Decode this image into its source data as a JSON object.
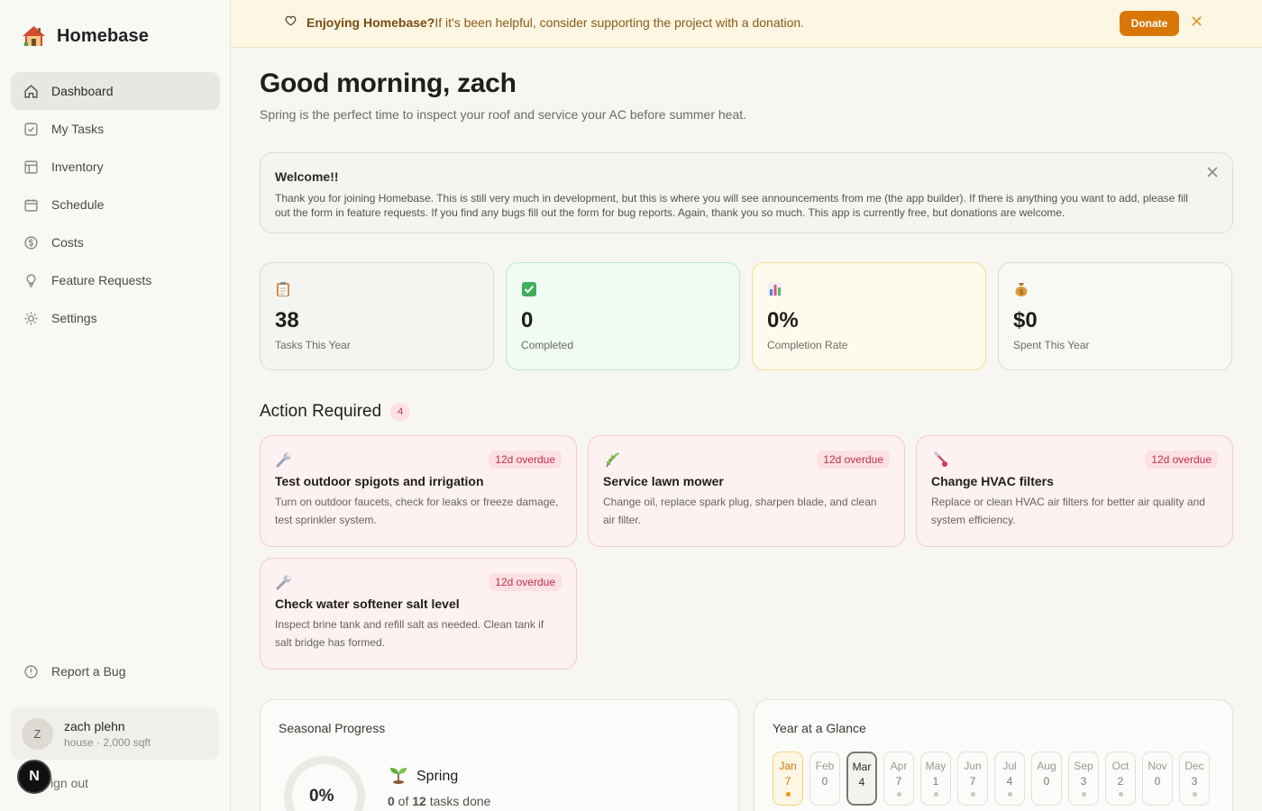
{
  "app": {
    "name": "Homebase"
  },
  "sidebar": {
    "items": [
      {
        "label": "Dashboard",
        "icon": "home-icon",
        "active": true
      },
      {
        "label": "My Tasks",
        "icon": "checkbox-icon"
      },
      {
        "label": "Inventory",
        "icon": "table-icon"
      },
      {
        "label": "Schedule",
        "icon": "calendar-icon"
      },
      {
        "label": "Costs",
        "icon": "coin-icon"
      },
      {
        "label": "Feature Requests",
        "icon": "lightbulb-icon"
      },
      {
        "label": "Settings",
        "icon": "sun-icon"
      }
    ],
    "report_bug": "Report a Bug",
    "user": {
      "initial": "Z",
      "name": "zach plehn",
      "sub": "house · 2,000 sqft"
    },
    "sign_out": "ign out",
    "n_badge": "N"
  },
  "banner": {
    "bold": "Enjoying Homebase?",
    "text": "If it's been helpful, consider supporting the project with a donation.",
    "donate": "Donate",
    "close": "✕"
  },
  "main": {
    "greeting": "Good morning, zach",
    "subtitle": "Spring is the perfect time to inspect your roof and service your AC before summer heat.",
    "welcome": {
      "title": "Welcome!!",
      "body": "Thank you for joining Homebase. This is still very much in development, but this is where you will see announcements from me (the app builder). If there is anything you want to add, please fill out the form in feature requests. If you find any bugs fill out the form for bug reports. Again, thank you so much. This app is currently free, but donations are welcome."
    },
    "stats": [
      {
        "value": "38",
        "label": "Tasks This Year",
        "icon": "clipboard-icon"
      },
      {
        "value": "0",
        "label": "Completed",
        "icon": "check-box-icon"
      },
      {
        "value": "0%",
        "label": "Completion Rate",
        "icon": "bar-chart-icon"
      },
      {
        "value": "$0",
        "label": "Spent This Year",
        "icon": "money-bag-icon"
      }
    ],
    "action_required": {
      "title": "Action Required",
      "count": "4"
    },
    "tasks": [
      {
        "title": "Test outdoor spigots and irrigation",
        "desc": "Turn on outdoor faucets, check for leaks or freeze damage, test sprinkler system.",
        "badge": "12d overdue",
        "icon": "wrench-icon"
      },
      {
        "title": "Service lawn mower",
        "desc": "Change oil, replace spark plug, sharpen blade, and clean air filter.",
        "badge": "12d overdue",
        "icon": "herb-icon"
      },
      {
        "title": "Change HVAC filters",
        "desc": "Replace or clean HVAC air filters for better air quality and system efficiency.",
        "badge": "12d overdue",
        "icon": "thermometer-icon"
      },
      {
        "title": "Check water softener salt level",
        "desc": "Inspect brine tank and refill salt as needed. Clean tank if salt bridge has formed.",
        "badge": "12d overdue",
        "icon": "wrench-icon"
      }
    ],
    "seasonal": {
      "title": "Seasonal Progress",
      "percent": "0%",
      "season": "Spring",
      "done_count": "0",
      "done_of": " of ",
      "total": "12",
      "done_suffix": " tasks done"
    },
    "year": {
      "title": "Year at a Glance",
      "months": [
        {
          "m": "Jan",
          "c": "7",
          "dot": true
        },
        {
          "m": "Feb",
          "c": "0",
          "dot": false
        },
        {
          "m": "Mar",
          "c": "4",
          "dot": false
        },
        {
          "m": "Apr",
          "c": "7",
          "dot": true
        },
        {
          "m": "May",
          "c": "1",
          "dot": true
        },
        {
          "m": "Jun",
          "c": "7",
          "dot": true
        },
        {
          "m": "Jul",
          "c": "4",
          "dot": true
        },
        {
          "m": "Aug",
          "c": "0",
          "dot": false
        },
        {
          "m": "Sep",
          "c": "3",
          "dot": true
        },
        {
          "m": "Oct",
          "c": "2",
          "dot": true
        },
        {
          "m": "Nov",
          "c": "0",
          "dot": false
        },
        {
          "m": "Dec",
          "c": "3",
          "dot": true
        }
      ]
    }
  }
}
